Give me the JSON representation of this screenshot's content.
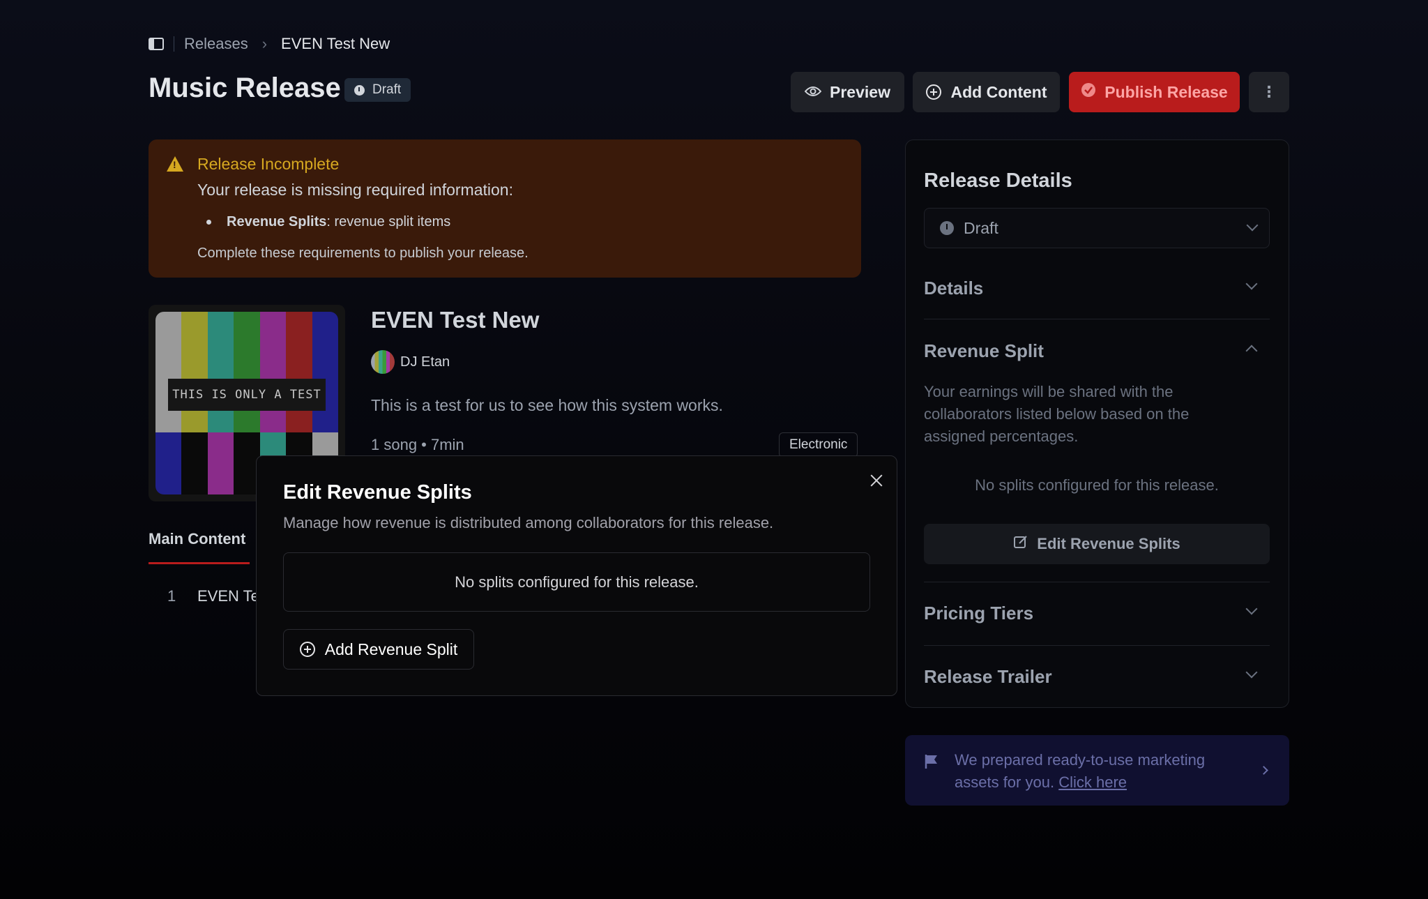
{
  "breadcrumb": {
    "releases": "Releases",
    "current": "EVEN Test New"
  },
  "header": {
    "title": "Music Release",
    "status_badge": "Draft",
    "preview_label": "Preview",
    "add_content_label": "Add Content",
    "publish_label": "Publish Release"
  },
  "alert": {
    "title": "Release Incomplete",
    "message": "Your release is missing required information:",
    "item_label": "Revenue Splits",
    "item_text": ": revenue split items",
    "footer": "Complete these requirements to publish your release."
  },
  "release": {
    "cover_text": "THIS IS ONLY A TEST",
    "name": "EVEN Test New",
    "artist": "DJ Etan",
    "description": "This is a test for us to see how this system works.",
    "meta": "1 song • 7min",
    "genre": "Electronic"
  },
  "tabs": {
    "main": "Main Content"
  },
  "tracks": [
    {
      "number": "1",
      "name": "EVEN Te"
    }
  ],
  "panel": {
    "title": "Release Details",
    "status_value": "Draft",
    "details": "Details",
    "revenue_split": "Revenue Split",
    "revenue_desc": "Your earnings will be shared with the collaborators listed below based on the assigned percentages.",
    "revenue_empty": "No splits configured for this release.",
    "edit_splits": "Edit Revenue Splits",
    "pricing_tiers": "Pricing Tiers",
    "release_trailer": "Release Trailer"
  },
  "marketing": {
    "text": "We prepared ready-to-use marketing assets for you.",
    "link": "Click here"
  },
  "modal": {
    "title": "Edit Revenue Splits",
    "description": "Manage how revenue is distributed among collaborators for this release.",
    "empty": "No splits configured for this release.",
    "add_label": "Add Revenue Split"
  },
  "colors": {
    "accent_red": "#b91c1c",
    "warning_yellow": "#d6a820",
    "marketing_bg": "#101030"
  }
}
